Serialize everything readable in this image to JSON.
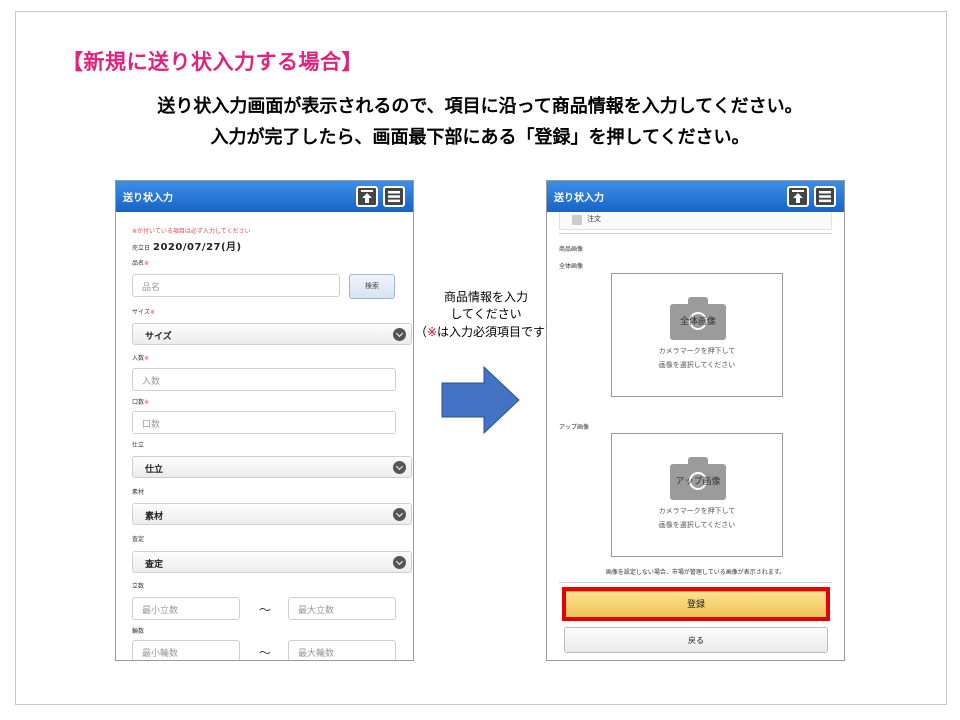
{
  "slide": {
    "heading": "【新規に送り状入力する場合】",
    "intro_line1": "送り状入力画面が表示されるので、項目に沿って商品情報を入力してください。",
    "intro_line2": "入力が完了したら、画面最下部にある「登録」を押してください。"
  },
  "left_phone": {
    "title": "送り状入力",
    "required_note": "※が付いている項目は必ず入力してください",
    "date_label": "売立日",
    "date_value": "2020/07/27(月)",
    "req_mark": "※",
    "fields": {
      "hinmei_label": "品名",
      "hinmei_placeholder": "品名",
      "search_button": "検索",
      "size_label": "サイズ",
      "size_value": "サイズ",
      "irisu_label": "入数",
      "irisu_placeholder": "入数",
      "kuchisu_label": "口数",
      "kuchisu_placeholder": "口数",
      "shitate_label": "仕立",
      "shitate_value": "仕立",
      "sozai_label": "素材",
      "sozai_value": "素材",
      "satei_label": "査定",
      "satei_value": "査定",
      "tachisu_label": "立数",
      "tachisu_min": "最小立数",
      "tachisu_max": "最大立数",
      "rinsu_label": "輪数",
      "rinsu_min": "最小輪数",
      "rinsu_max": "最大輪数",
      "tilde": "〜"
    }
  },
  "middle": {
    "line1": "商品情報を入力",
    "line2": "してください",
    "line3_open": "（",
    "line3_req": "※",
    "line3_rest": "は入力必須項目です）"
  },
  "right_phone": {
    "title": "送り状入力",
    "order_checkbox": "注文",
    "product_image_label": "商品画像",
    "full_image_label": "全体画像",
    "full_camera_caption": "全体画像",
    "camera_msg_1": "カメラマークを押下して",
    "camera_msg_2": "画像を選択してください",
    "up_image_label": "アップ画像",
    "up_camera_caption": "アップ画像",
    "footer_note": "画像を設定しない場合、市場が管理している画像が表示されます。",
    "register_button": "登録",
    "back_button": "戻る"
  },
  "colors": {
    "heading": "#e2237d",
    "required": "#e24a4a",
    "highlight": "#e60000",
    "arrow": "#4472c4",
    "appbar": "#1763c6"
  }
}
